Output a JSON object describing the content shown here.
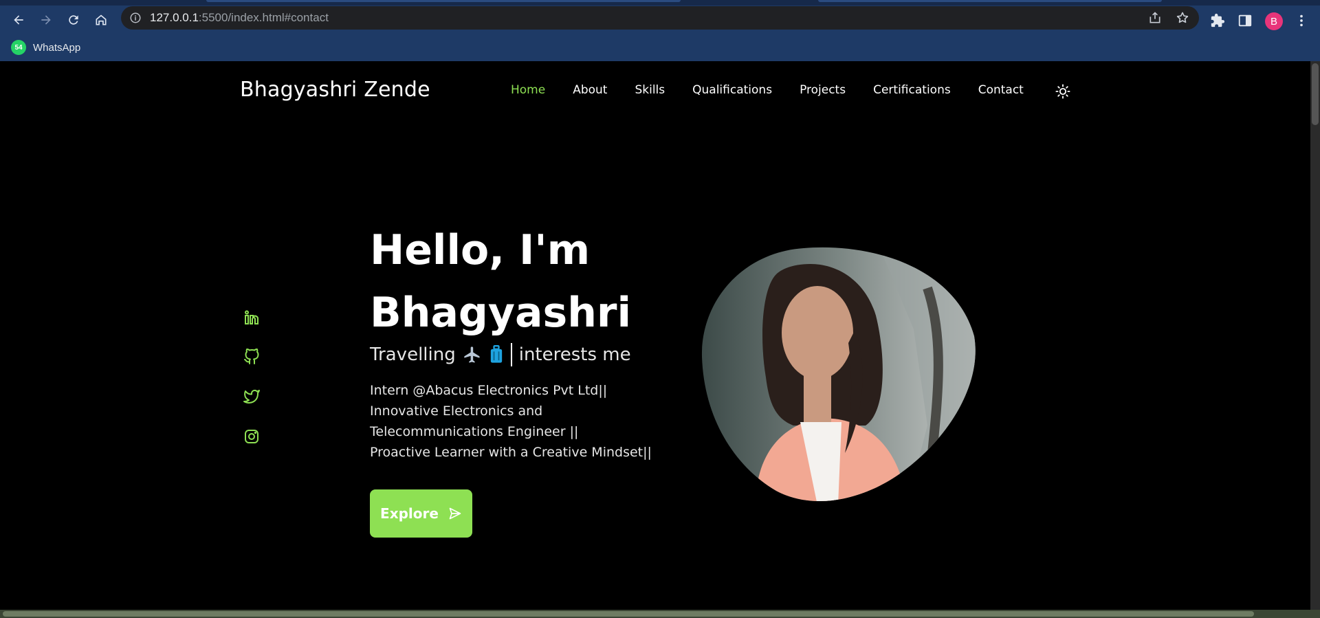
{
  "browser": {
    "url_host": "127.0.0.1",
    "url_path": ":5500/index.html#contact",
    "profile_initial": "B",
    "bookmarks": [
      {
        "label": "WhatsApp",
        "badge": "54"
      }
    ]
  },
  "site": {
    "brand": "Bhagyashri Zende",
    "nav": [
      {
        "label": "Home",
        "active": true
      },
      {
        "label": "About",
        "active": false
      },
      {
        "label": "Skills",
        "active": false
      },
      {
        "label": "Qualifications",
        "active": false
      },
      {
        "label": "Projects",
        "active": false
      },
      {
        "label": "Certifications",
        "active": false
      },
      {
        "label": "Contact",
        "active": false
      }
    ]
  },
  "hero": {
    "greeting": "Hello, I'm",
    "name": "Bhagyashri",
    "typing_prefix": "Travelling",
    "typing_suffix": "interests me",
    "description_lines": [
      "Intern @Abacus Electronics Pvt Ltd||",
      "Innovative Electronics and",
      "Telecommunications Engineer ||",
      "Proactive Learner with a Creative Mindset||"
    ],
    "button_label": "Explore"
  },
  "social": [
    "linkedin-icon",
    "github-icon",
    "twitter-icon",
    "instagram-icon"
  ],
  "colors": {
    "accent": "#8ee053",
    "background": "#000000",
    "chrome": "#1e3a66"
  }
}
